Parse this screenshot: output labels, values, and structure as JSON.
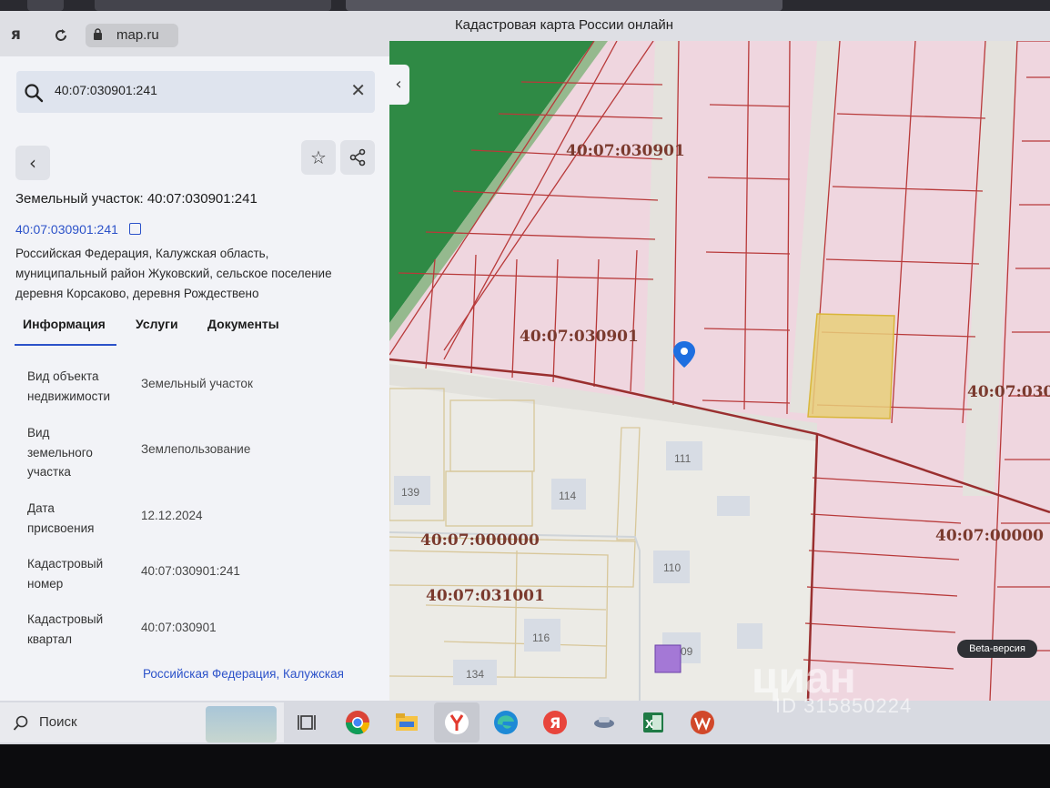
{
  "browser": {
    "url": "map.ru",
    "page_title": "Кадастровая карта России онлайн"
  },
  "search": {
    "query": "40:07:030901:241"
  },
  "object": {
    "title": "Земельный участок: 40:07:030901:241",
    "cadastral_link": "40:07:030901:241",
    "address_lines": [
      "Российская Федерация, Калужская область,",
      "муниципальный район Жуковский, сельское поселение",
      "деревня Корсаково, деревня Рождествено"
    ]
  },
  "tabs": [
    {
      "label": "Информация",
      "active": true
    },
    {
      "label": "Услуги",
      "active": false
    },
    {
      "label": "Документы",
      "active": false
    }
  ],
  "info_rows": [
    {
      "label_lines": [
        "Вид объекта",
        "недвижимости"
      ],
      "value": "Земельный участок"
    },
    {
      "label_lines": [
        "Вид",
        "земельного",
        "участка"
      ],
      "value": "Землепользование"
    },
    {
      "label_lines": [
        "Дата",
        "присвоения"
      ],
      "value": "12.12.2024"
    },
    {
      "label_lines": [
        "Кадастровый",
        "номер"
      ],
      "value": "40:07:030901:241"
    },
    {
      "label_lines": [
        "Кадастровый",
        "квартал"
      ],
      "value": "40:07:030901"
    }
  ],
  "address_tail": "Российская Федерация, Калужская",
  "map": {
    "quarter_labels": [
      "40:07:030901",
      "40:07:030901",
      "40:07:030",
      "40:07:000000",
      "40:07:031001",
      "40:07:00000"
    ],
    "building_numbers": [
      "139",
      "114",
      "111",
      "110",
      "116",
      "09",
      "134"
    ],
    "beta_label": "Beta-версия"
  },
  "watermark": {
    "brand": "циан",
    "listing_id": "ID 315850224"
  },
  "taskbar": {
    "search_label": "Поиск"
  },
  "colors": {
    "accent": "#2c52c9",
    "map_marker": "#1e6fe0",
    "selected_parcel": "#e8cf7a",
    "forest": "#2f8a45",
    "parcel_fill": "#efd2dc",
    "parcel_border": "#b83a3a"
  }
}
